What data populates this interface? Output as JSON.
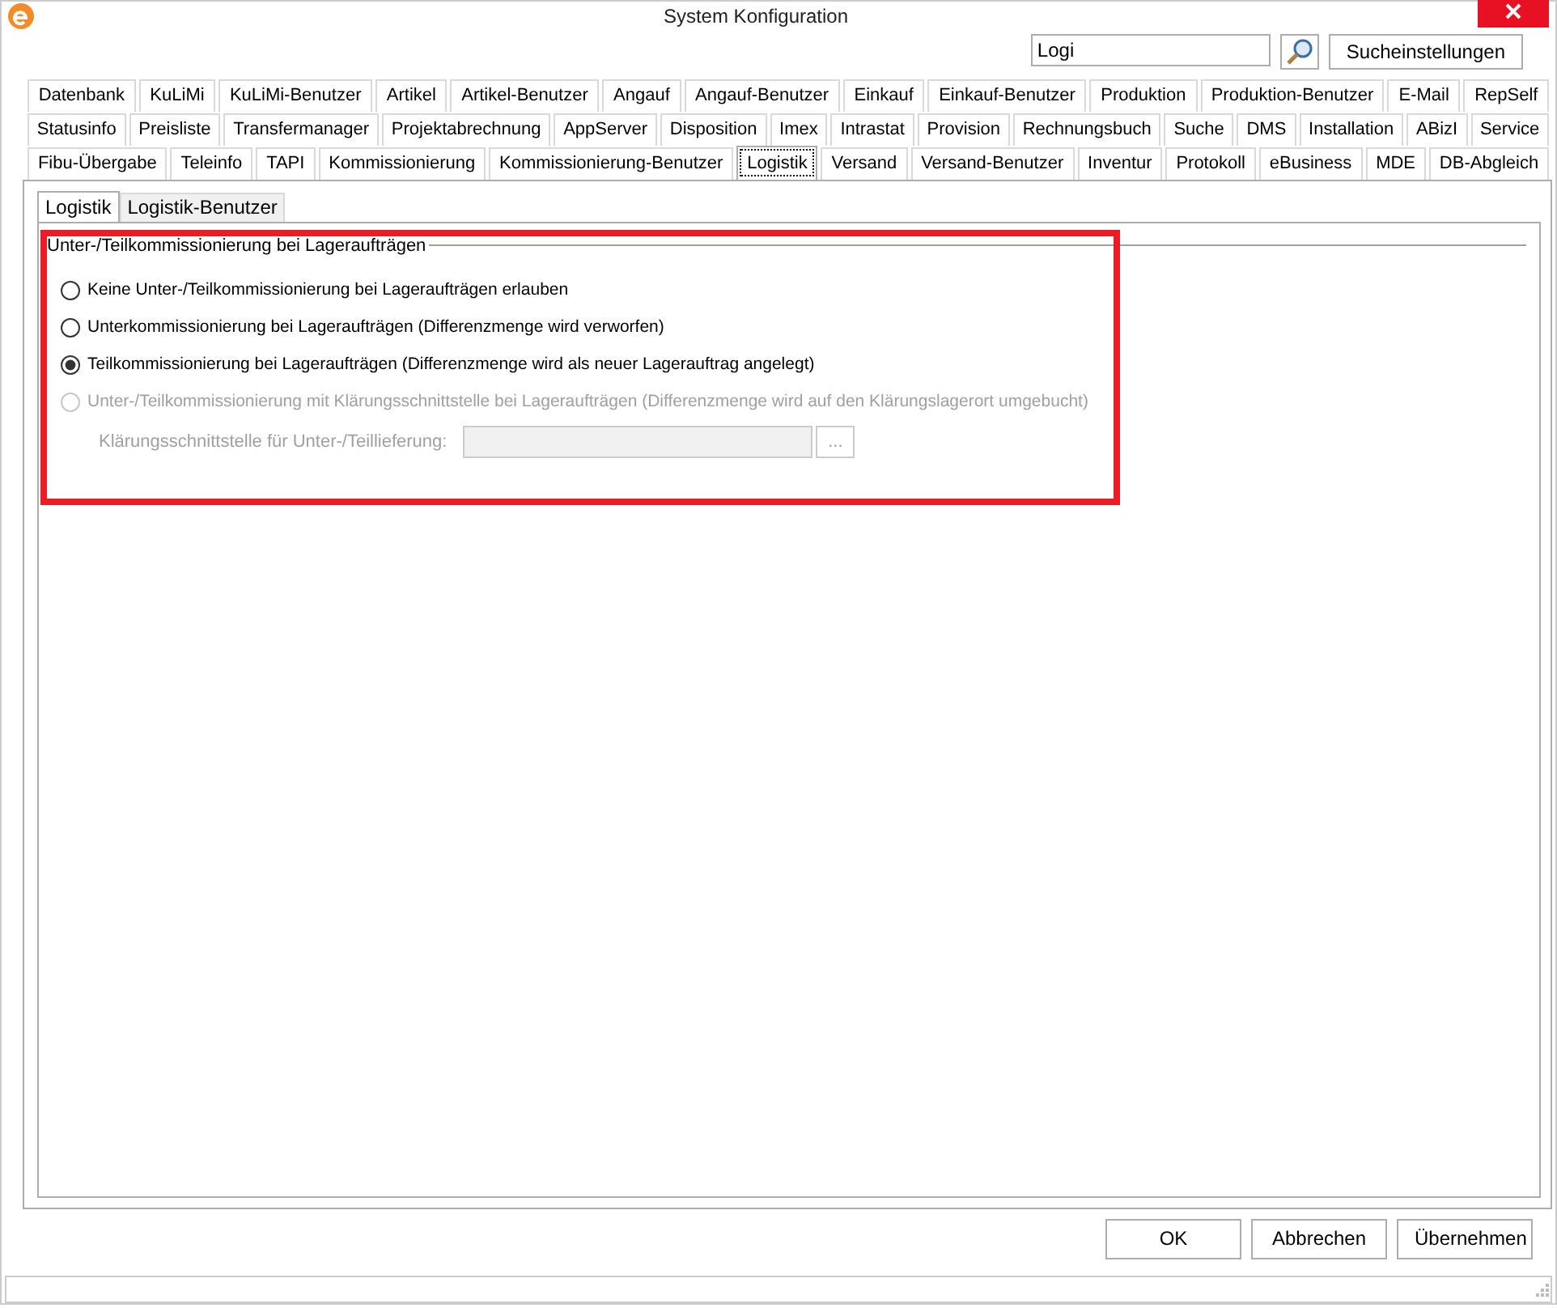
{
  "window": {
    "title": "System Konfiguration"
  },
  "search": {
    "value": "Logi",
    "button": "Sucheinstellungen"
  },
  "tab_rows": [
    [
      {
        "label": "Datenbank",
        "selected": false
      },
      {
        "label": "KuLiMi",
        "selected": false
      },
      {
        "label": "KuLiMi-Benutzer",
        "selected": false
      },
      {
        "label": "Artikel",
        "selected": false
      },
      {
        "label": "Artikel-Benutzer",
        "selected": false
      },
      {
        "label": "Angauf",
        "selected": false
      },
      {
        "label": "Angauf-Benutzer",
        "selected": false
      },
      {
        "label": "Einkauf",
        "selected": false
      },
      {
        "label": "Einkauf-Benutzer",
        "selected": false
      },
      {
        "label": "Produktion",
        "selected": false
      },
      {
        "label": "Produktion-Benutzer",
        "selected": false
      },
      {
        "label": "E-Mail",
        "selected": false
      },
      {
        "label": "RepSelf",
        "selected": false
      }
    ],
    [
      {
        "label": "Statusinfo",
        "selected": false
      },
      {
        "label": "Preisliste",
        "selected": false
      },
      {
        "label": "Transfermanager",
        "selected": false
      },
      {
        "label": "Projektabrechnung",
        "selected": false
      },
      {
        "label": "AppServer",
        "selected": false
      },
      {
        "label": "Disposition",
        "selected": false
      },
      {
        "label": "Imex",
        "selected": false
      },
      {
        "label": "Intrastat",
        "selected": false
      },
      {
        "label": "Provision",
        "selected": false
      },
      {
        "label": "Rechnungsbuch",
        "selected": false
      },
      {
        "label": "Suche",
        "selected": false
      },
      {
        "label": "DMS",
        "selected": false
      },
      {
        "label": "Installation",
        "selected": false
      },
      {
        "label": "ABizI",
        "selected": false
      },
      {
        "label": "Service",
        "selected": false
      }
    ],
    [
      {
        "label": "Fibu-Übergabe",
        "selected": false
      },
      {
        "label": "Teleinfo",
        "selected": false
      },
      {
        "label": "TAPI",
        "selected": false
      },
      {
        "label": "Kommissionierung",
        "selected": false
      },
      {
        "label": "Kommissionierung-Benutzer",
        "selected": false
      },
      {
        "label": "Logistik",
        "selected": true
      },
      {
        "label": "Versand",
        "selected": false
      },
      {
        "label": "Versand-Benutzer",
        "selected": false
      },
      {
        "label": "Inventur",
        "selected": false
      },
      {
        "label": "Protokoll",
        "selected": false
      },
      {
        "label": "eBusiness",
        "selected": false
      },
      {
        "label": "MDE",
        "selected": false
      },
      {
        "label": "DB-Abgleich",
        "selected": false
      }
    ]
  ],
  "sub_tabs": [
    {
      "label": "Logistik",
      "selected": true
    },
    {
      "label": "Logistik-Benutzer",
      "selected": false
    }
  ],
  "group": {
    "title": "Unter-/Teilkommissionierung bei Lageraufträgen",
    "highlighted": true,
    "options": [
      {
        "label": "Keine Unter-/Teilkommissionierung bei Lageraufträgen erlauben",
        "selected": false,
        "disabled": false
      },
      {
        "label": "Unterkommissionierung bei Lageraufträgen (Differenzmenge wird verworfen)",
        "selected": false,
        "disabled": false
      },
      {
        "label": "Teilkommissionierung bei Lageraufträgen (Differenzmenge wird als neuer Lagerauftrag angelegt)",
        "selected": true,
        "disabled": false
      },
      {
        "label": "Unter-/Teilkommissionierung mit Klärungsschnittstelle bei Lageraufträgen (Differenzmenge wird auf den Klärungslagerort umgebucht)",
        "selected": false,
        "disabled": true
      }
    ],
    "field": {
      "label": "Klärungsschnittstelle für Unter-/Teillieferung:",
      "disabled": true,
      "browse": "..."
    }
  },
  "buttons": [
    "OK",
    "Abbrechen",
    "Übernehmen"
  ]
}
